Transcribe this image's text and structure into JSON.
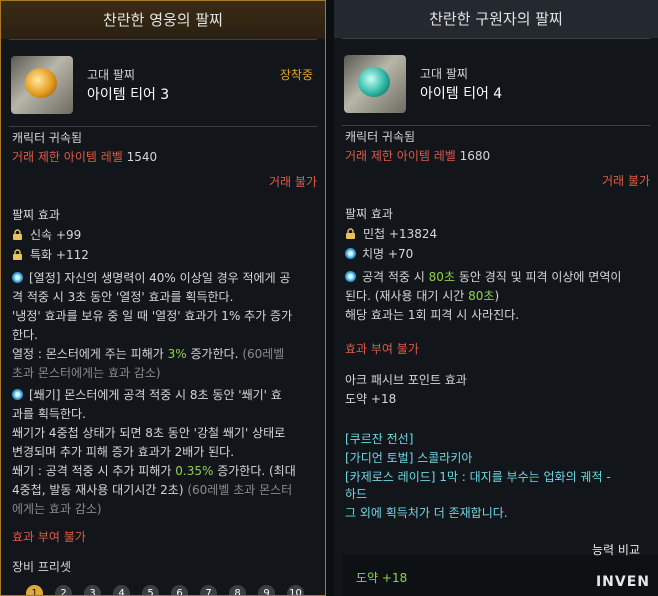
{
  "left": {
    "title": "찬란한 영웅의 팔찌",
    "grade": "고대 팔찌",
    "tier": "아이템 티어 3",
    "equipped": "장착중",
    "bound": "캐릭터 귀속됨",
    "trade_level_label": "거래 제한 아이템 레벨",
    "trade_level": "1540",
    "trade": "거래 불가",
    "effects_heading": "팔찌 효과",
    "stat1": "신속 +99",
    "stat2": "특화 +112",
    "e1_l1": "[열정] 자신의 생명력이 40% 이상일 경우 적에게 공",
    "e1_l2": "격 적중 시 3초 동안 '열정' 효과를 획득한다.",
    "e1_l3": "'냉정' 효과를 보유 중 일 때 '열정' 효과가 1% 추가 증가",
    "e1_l4": "한다.",
    "e1_l5a": "열정 : 몬스터에게 주는 피해가",
    "e1_l5b": "3%",
    "e1_l5c": "증가한다.",
    "e1_l5d": "(60레벨",
    "e1_l6": "초과 몬스터에게는 효과 감소)",
    "e2_l1": "[쐐기] 몬스터에게 공격 적중 시 8초 동안 '쐐기' 효",
    "e2_l2": "과를 획득한다.",
    "e2_l3": "쐐기가 4중첩 상태가 되면 8초 동안 '강철 쐐기' 상태로",
    "e2_l4": "변경되며 추가 피해 증가 효과가 2배가 된다.",
    "e2_l5a": "쐐기 : 공격 적중 시 추가 피해가",
    "e2_l5b": "0.35%",
    "e2_l5c": "증가한다. (최대",
    "e2_l6a": "4중첩, 발동 재사용 대기시간 2초)",
    "e2_l6b": "(60레벨 초과 몬스터",
    "e2_l7": "에게는 효과 감소)",
    "enchant": "효과 부여 불가",
    "preset_heading": "장비 프리셋",
    "presets": [
      "1",
      "2",
      "3",
      "4",
      "5",
      "6",
      "7",
      "8",
      "9",
      "10"
    ]
  },
  "right": {
    "title": "찬란한 구원자의 팔찌",
    "grade": "고대 팔찌",
    "tier": "아이템 티어 4",
    "bound": "캐릭터 귀속됨",
    "trade_level_label": "거래 제한 아이템 레벨",
    "trade_level": "1680",
    "trade": "거래 불가",
    "effects_heading": "팔찌 효과",
    "stat1": "민첩 +13824",
    "stat2": "치명 +70",
    "e1_l1a": "공격 적중 시",
    "e1_l1b": "80초",
    "e1_l1c": "동안 경직 및 피격 이상에 면역이",
    "e1_l2a": "된다. (재사용 대기 시간",
    "e1_l2b": "80초",
    "e1_l2c": ")",
    "e1_l3": "해당 효과는 1회 피격 시 사라진다.",
    "enchant": "효과 부여 불가",
    "ark_heading": "아크 패시브 포인트 효과",
    "ark_value": "도약 +18",
    "src1": "[쿠르잔 전선]",
    "src2": "[가디언 토벌] 스콜라키아",
    "src3": "[카제로스 레이드] 1막 : 대지를 부수는 업화의 궤적 -",
    "src4": "하드",
    "src5": "그 외에 획득처가 더 존재합니다.",
    "compare_label": "능력 비교",
    "compare_value": "도약 +18"
  },
  "watermark": "INVEN"
}
